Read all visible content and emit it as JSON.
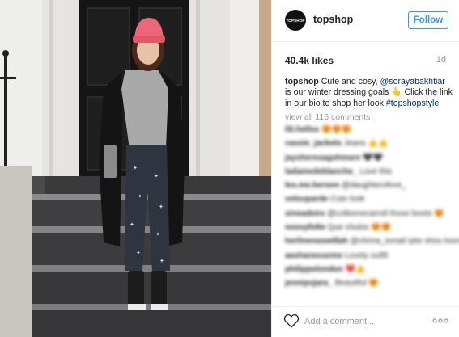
{
  "account": {
    "avatar_text": "TOPSHOP",
    "username": "topshop",
    "follow_label": "Follow"
  },
  "post": {
    "likes": "40.4k likes",
    "age": "1d",
    "caption": {
      "user": "topshop",
      "text_1": " Cute and cosy, ",
      "mention": "@sorayabakhtiar",
      "text_2": " is our winter dressing goals ",
      "emoji": "👆",
      "text_3": " Click the link in our bio to shop her look ",
      "hashtag": "#topshopstyle"
    },
    "view_all_label": "view all 116 comments"
  },
  "comments": [
    {
      "user": "lili.hellss",
      "text": "",
      "emoji": "😍😍😍"
    },
    {
      "user": "cassie_jackets",
      "text": "Jeans",
      "emoji": "👍👍"
    },
    {
      "user": "jaysheresagshmare",
      "text": "",
      "emoji": "🖤🖤"
    },
    {
      "user": "ladamedeblanche_",
      "text": "Love this",
      "emoji": ""
    },
    {
      "user": "les.me.herson",
      "text": "@daughterofeve_",
      "emoji": ""
    },
    {
      "user": "velouparde",
      "text": "Cute look",
      "emoji": ""
    },
    {
      "user": "sineadeire",
      "text": "@colleenecarroll those boots",
      "emoji": "😍"
    },
    {
      "user": "nossyfolte",
      "text": "Que chulos",
      "emoji": "😍😍"
    },
    {
      "user": "herlinenaswillah",
      "text": "@chrina_ismail iyke shou loonsink",
      "emoji": ""
    },
    {
      "user": "aashanesseme",
      "text": "Lovely outfit",
      "emoji": ""
    },
    {
      "user": "philippelondon",
      "text": "",
      "emoji": "❤️👍"
    },
    {
      "user": "jennipujara_",
      "text": "Beautiful",
      "emoji": "😍"
    }
  ],
  "footer": {
    "comment_placeholder": "Add a comment..."
  },
  "colors": {
    "accent": "#3897f0",
    "link": "#003569",
    "muted": "#999999",
    "hat": "#ec6878",
    "door": "#141414"
  },
  "icons": [
    "heart-icon",
    "more-options-icon"
  ]
}
